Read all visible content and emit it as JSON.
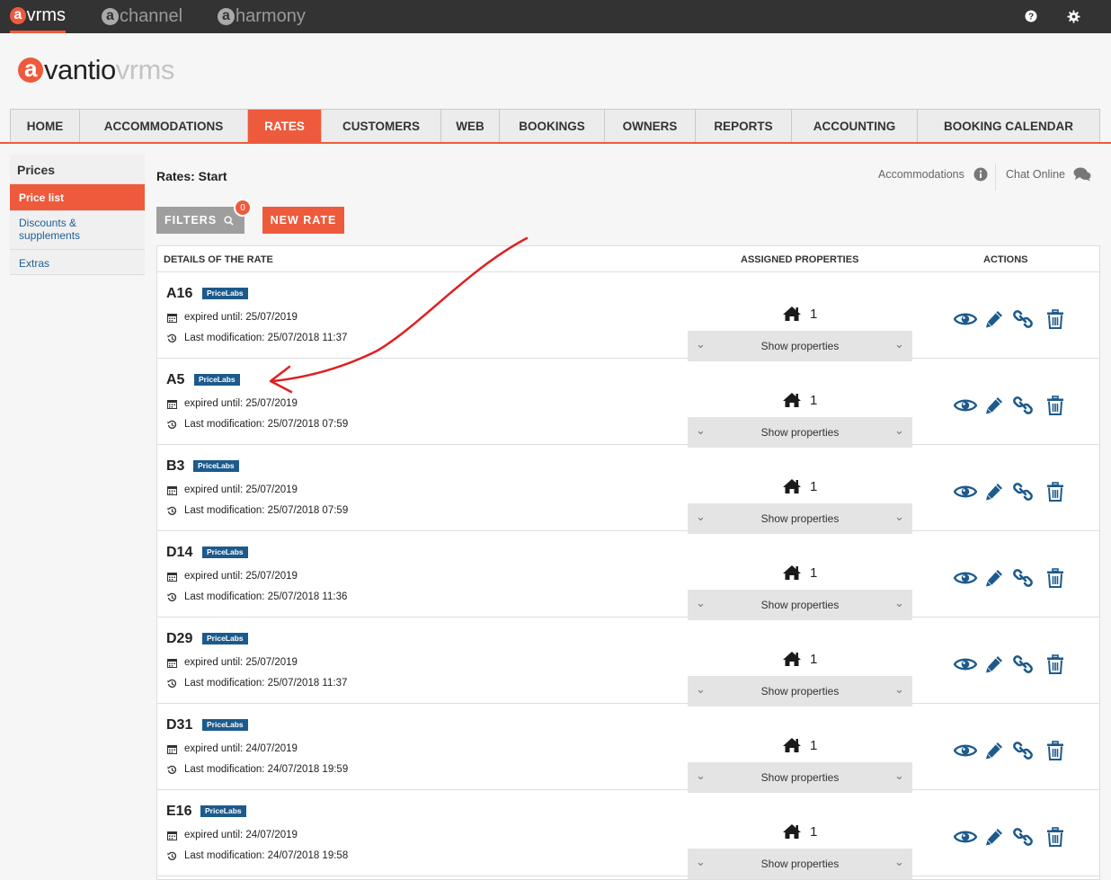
{
  "apps": [
    {
      "letter": "a",
      "name": "vrms",
      "active": true
    },
    {
      "letter": "a",
      "name": "channel",
      "active": false
    },
    {
      "letter": "a",
      "name": "harmony",
      "active": false
    }
  ],
  "topbar_icons": [
    "help-icon",
    "gear-icon"
  ],
  "logo": {
    "letter": "a",
    "brand": "vantio",
    "suffix": "vrms"
  },
  "nav": [
    "HOME",
    "ACCOMMODATIONS",
    "RATES",
    "CUSTOMERS",
    "WEB",
    "BOOKINGS",
    "OWNERS",
    "REPORTS",
    "ACCOUNTING",
    "BOOKING CALENDAR"
  ],
  "nav_active": "RATES",
  "sidebar": {
    "heading": "Prices",
    "items": [
      "Price list",
      "Discounts & supplements",
      "Extras"
    ],
    "active": "Price list"
  },
  "page": {
    "breadcrumb": "Rates: Start"
  },
  "top_links": {
    "accommodations": "Accommodations",
    "chat": "Chat Online"
  },
  "toolbar": {
    "filters_label": "FILTERS",
    "filters_count": "0",
    "new_rate_label": "NEW RATE"
  },
  "table": {
    "headers": {
      "details": "DETAILS OF THE RATE",
      "assigned": "ASSIGNED PROPERTIES",
      "actions": "ACTIONS"
    },
    "rows": [
      {
        "name": "A16",
        "tag": "PriceLabs",
        "expired": "expired until: 25/07/2019",
        "modified": "Last modification: 25/07/2018 11:37",
        "count": "1",
        "show": "Show properties"
      },
      {
        "name": "A5",
        "tag": "PriceLabs",
        "expired": "expired until: 25/07/2019",
        "modified": "Last modification: 25/07/2018 07:59",
        "count": "1",
        "show": "Show properties"
      },
      {
        "name": "B3",
        "tag": "PriceLabs",
        "expired": "expired until: 25/07/2019",
        "modified": "Last modification: 25/07/2018 07:59",
        "count": "1",
        "show": "Show properties"
      },
      {
        "name": "D14",
        "tag": "PriceLabs",
        "expired": "expired until: 25/07/2019",
        "modified": "Last modification: 25/07/2018 11:36",
        "count": "1",
        "show": "Show properties"
      },
      {
        "name": "D29",
        "tag": "PriceLabs",
        "expired": "expired until: 25/07/2019",
        "modified": "Last modification: 25/07/2018 11:37",
        "count": "1",
        "show": "Show properties"
      },
      {
        "name": "D31",
        "tag": "PriceLabs",
        "expired": "expired until: 24/07/2019",
        "modified": "Last modification: 24/07/2018 19:59",
        "count": "1",
        "show": "Show properties"
      },
      {
        "name": "E16",
        "tag": "PriceLabs",
        "expired": "expired until: 24/07/2019",
        "modified": "Last modification: 24/07/2018 19:58",
        "count": "1",
        "show": "Show properties"
      }
    ]
  },
  "colors": {
    "accent": "#ee5a3c",
    "blue": "#1d5a8c",
    "topbar": "#333333",
    "annotation": "#e02020"
  }
}
